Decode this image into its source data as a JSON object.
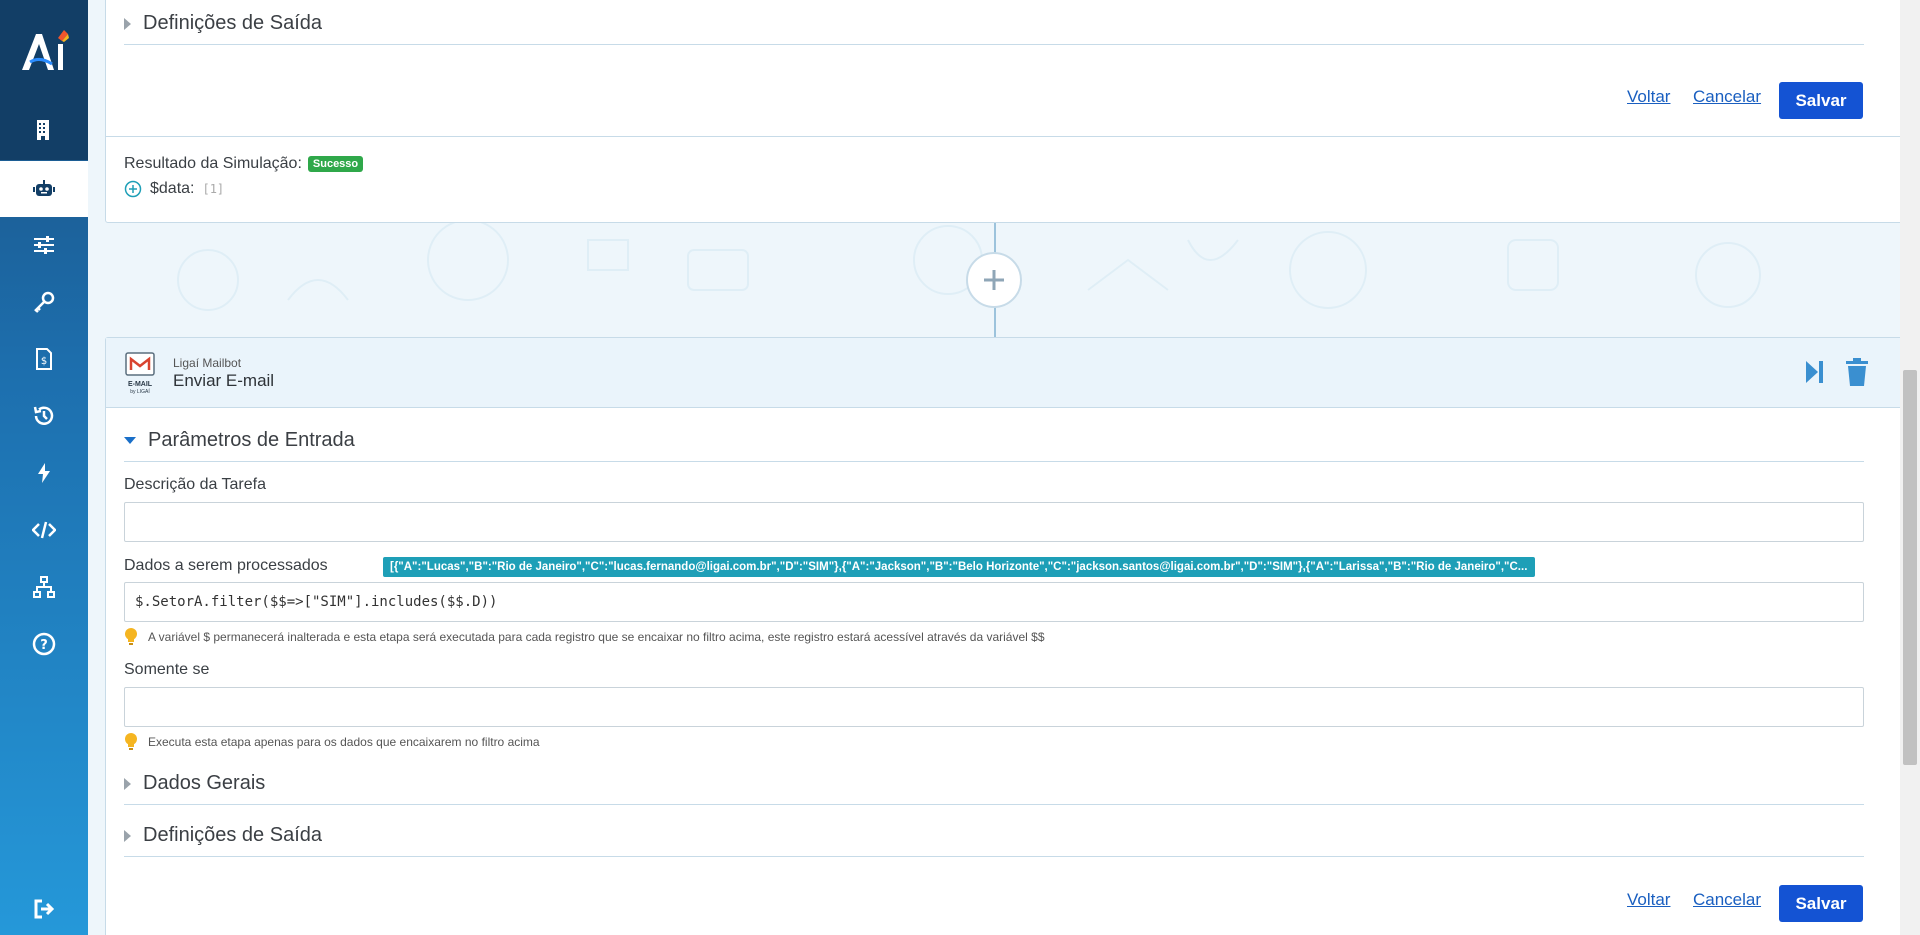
{
  "top_card": {
    "section_output": "Definições de Saída",
    "btn_back": "Voltar",
    "btn_cancel": "Cancelar",
    "btn_save": "Salvar",
    "sim_label": "Resultado da Simulação:",
    "sim_status": "Sucesso",
    "data_key": "$data:",
    "data_value": "[1]"
  },
  "task_card": {
    "provider": "Ligaí Mailbot",
    "title": "Enviar E-mail",
    "icon_caption": "E-MAIL",
    "icon_sub": "by LIGAÍ",
    "section_input": "Parâmetros de Entrada",
    "desc_label": "Descrição da Tarefa",
    "desc_value": "",
    "data_label": "Dados a serem processados",
    "data_preview": "[{\"A\":\"Lucas\",\"B\":\"Rio de Janeiro\",\"C\":\"lucas.fernando@ligai.com.br\",\"D\":\"SIM\"},{\"A\":\"Jackson\",\"B\":\"Belo Horizonte\",\"C\":\"jackson.santos@ligai.com.br\",\"D\":\"SIM\"},{\"A\":\"Larissa\",\"B\":\"Rio de Janeiro\",\"C...",
    "data_value": "$.SetorA.filter($$=>[\"SIM\"].includes($$.D))",
    "data_hint": "A variável $ permanecerá inalterada e esta etapa será executada para cada registro que se encaixar no filtro acima, este registro estará acessível através da variável $$",
    "only_if_label": "Somente se",
    "only_if_value": "",
    "only_if_hint": "Executa esta etapa apenas para os dados que encaixarem no filtro acima",
    "section_general": "Dados Gerais",
    "section_output": "Definições de Saída",
    "btn_back": "Voltar",
    "btn_cancel": "Cancelar",
    "btn_save": "Salvar"
  },
  "colors": {
    "accent": "#1453d3",
    "success": "#2fa84a",
    "data_badge": "#1e9fb7",
    "sidebar_top": "#123e66"
  },
  "sidebar": {
    "items": [
      "building-icon",
      "robot-icon",
      "sliders-icon",
      "key-icon",
      "invoice-icon",
      "history-icon",
      "bolt-icon",
      "code-icon",
      "network-icon",
      "help-icon",
      "logout-icon"
    ]
  }
}
